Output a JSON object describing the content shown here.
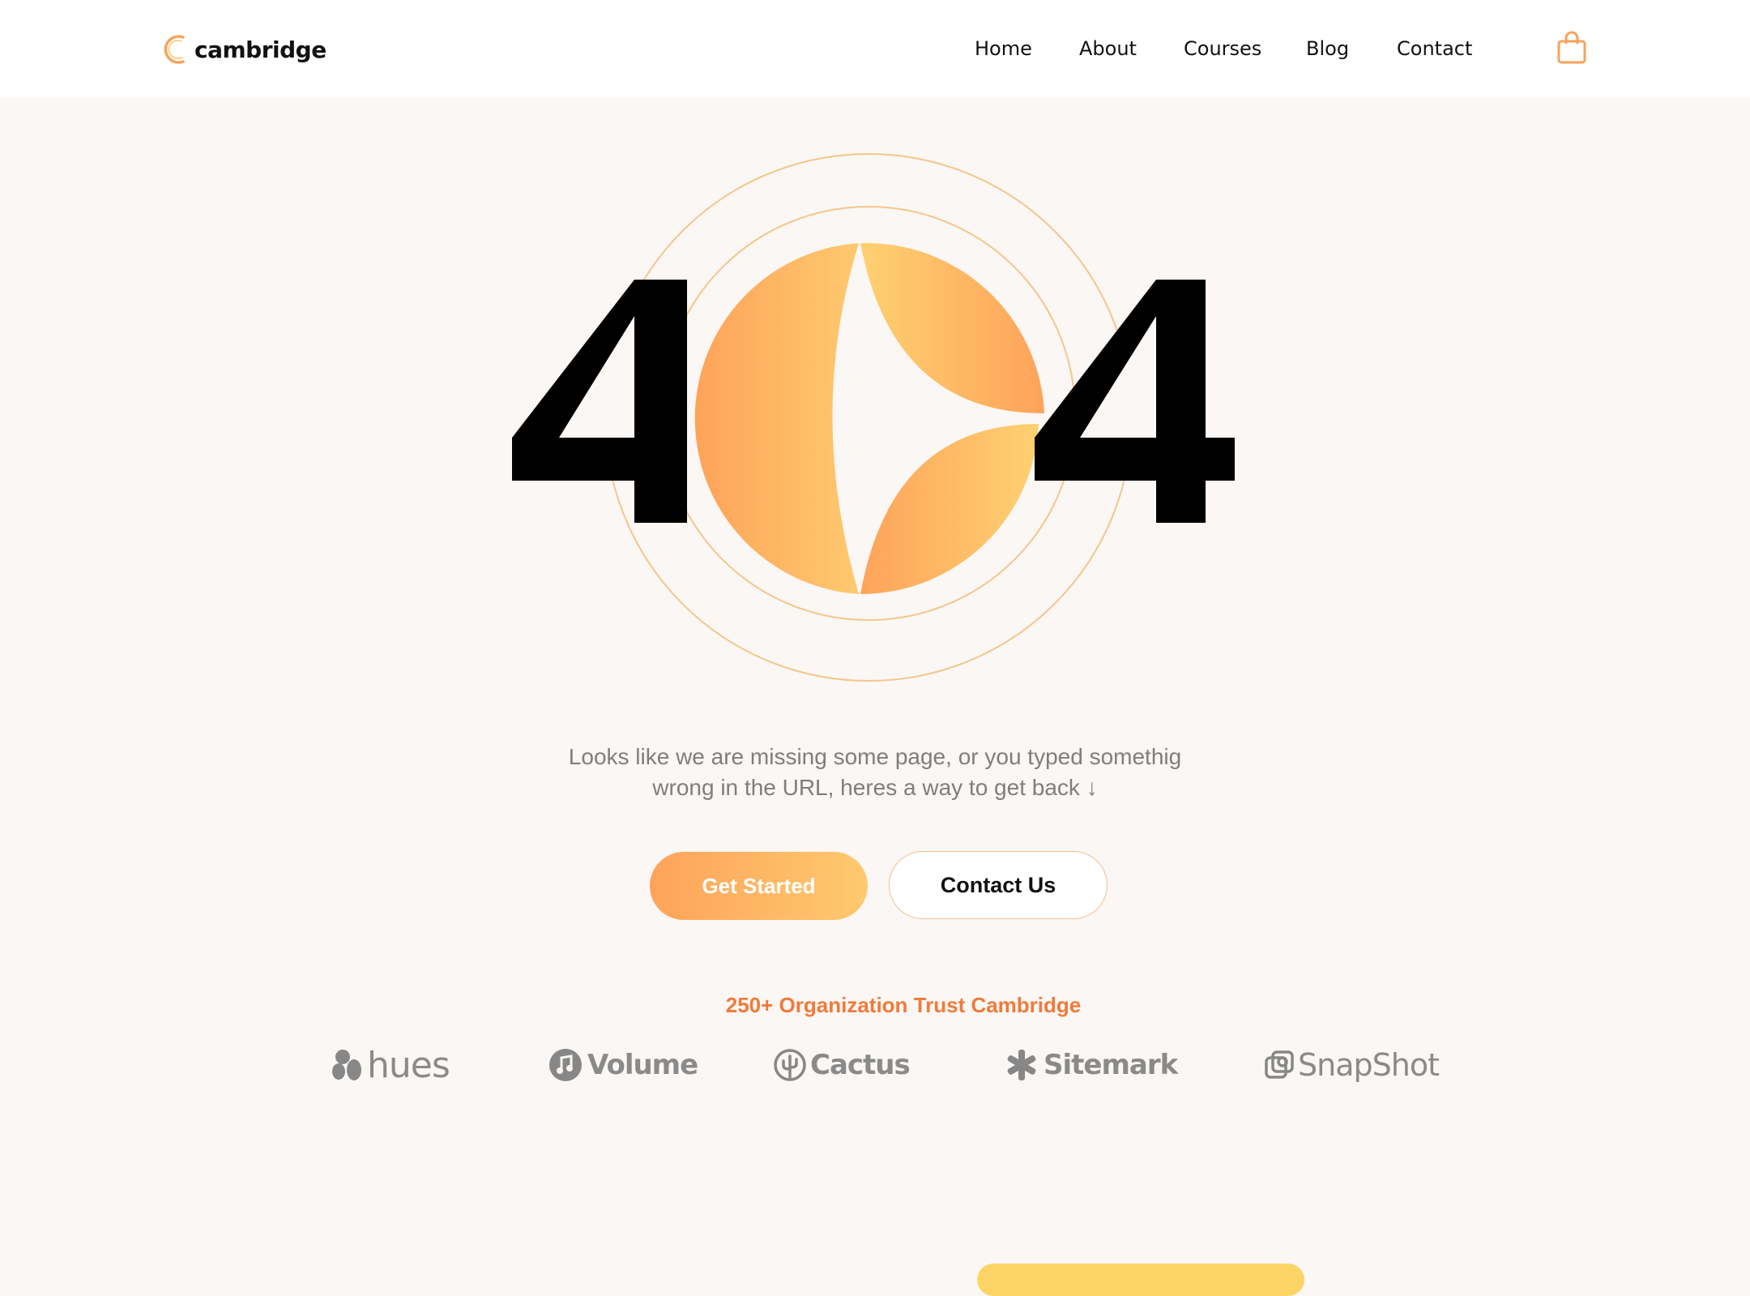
{
  "brand": {
    "name": "cambridge"
  },
  "nav": {
    "items": [
      "Home",
      "About",
      "Courses",
      "Blog",
      "Contact"
    ]
  },
  "hero": {
    "error_code_left": "4",
    "error_code_right": "4",
    "message_line1": "Looks like we are missing some page, or you typed somethig",
    "message_line2": "wrong in the URL, heres a way to get back ↓",
    "primary_button": "Get Started",
    "secondary_button": "Contact  Us"
  },
  "trust": {
    "title": "250+ Organization Trust Cambridge",
    "logos": [
      "hues",
      "Volume",
      "Cactus",
      "Sitemark",
      "SnapShot"
    ]
  },
  "colors": {
    "accent_orange": "#fea35a",
    "accent_yellow": "#fec96f",
    "trust_text": "#f07a3a",
    "background": "#faf7f4"
  },
  "icons": [
    "logo-c-icon",
    "shopping-bag-icon",
    "hues-logo-icon",
    "volume-logo-icon",
    "cactus-logo-icon",
    "sitemark-logo-icon",
    "snapshot-logo-icon"
  ]
}
